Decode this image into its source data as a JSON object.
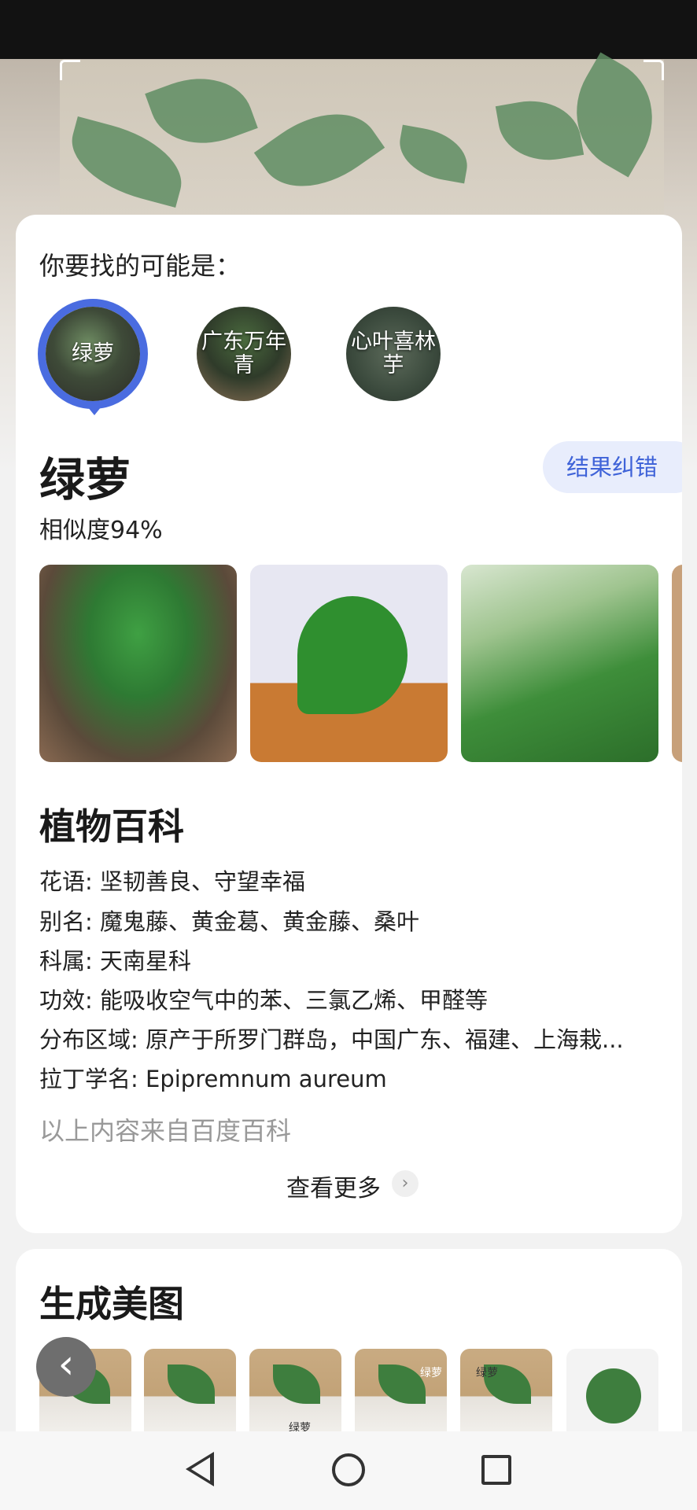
{
  "prompt": "你要找的可能是：",
  "candidates": [
    {
      "label": "绿萝",
      "selected": true
    },
    {
      "label": "广东万年青",
      "selected": false
    },
    {
      "label": "心叶喜林芋",
      "selected": false
    }
  ],
  "result": {
    "name": "绿萝",
    "similarity": "相似度94%",
    "correct_button": "结果纠错"
  },
  "encyclopedia": {
    "title": "植物百科",
    "lines": [
      {
        "key": "花语:",
        "value": "坚韧善良、守望幸福"
      },
      {
        "key": "别名:",
        "value": "魔鬼藤、黄金葛、黄金藤、桑叶"
      },
      {
        "key": "科属:",
        "value": "天南星科"
      },
      {
        "key": "功效:",
        "value": "能吸收空气中的苯、三氯乙烯、甲醛等"
      },
      {
        "key": "分布区域:",
        "value": "原产于所罗门群岛，中国广东、福建、上海栽..."
      },
      {
        "key": "拉丁学名:",
        "value": "Epipremnum aureum"
      }
    ],
    "source": "以上内容来自百度百科",
    "see_more": "查看更多"
  },
  "generate": {
    "title": "生成美图",
    "captions": [
      "绿萝",
      "绿萝",
      "绿萝"
    ]
  },
  "colors": {
    "accent": "#4a6ce0",
    "accent_bg": "#e8edfc"
  },
  "icons": {
    "chevron": "chevron-right-icon",
    "back": "chevron-left-icon"
  }
}
